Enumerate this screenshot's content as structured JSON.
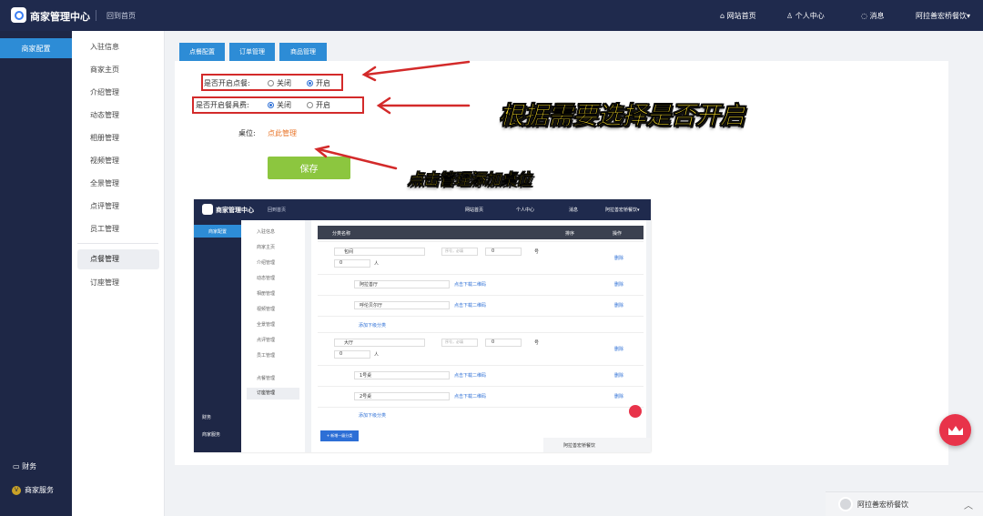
{
  "app": {
    "title": "商家管理中心",
    "home_link": "回到首页"
  },
  "header": {
    "links": [
      "网站首页",
      "个人中心",
      "消息"
    ],
    "account": "阿拉善宏桥餐饮"
  },
  "sidenav": {
    "active": "商家配置",
    "bottom": [
      "财务",
      "商家服务"
    ]
  },
  "subnav": {
    "items": [
      "入驻信息",
      "商家主页",
      "介绍管理",
      "动态管理",
      "相册管理",
      "视频管理",
      "全景管理",
      "点评管理",
      "员工管理"
    ],
    "active": "点餐管理",
    "after": "订座管理"
  },
  "tabs": [
    "点餐配置",
    "订单管理",
    "商品管理"
  ],
  "form": {
    "q1": "是否开启点餐:",
    "q2": "是否开启餐具费:",
    "off": "关闭",
    "on": "开启",
    "table_label": "桌位:",
    "table_link": "点此管理",
    "save": "保存"
  },
  "callouts": {
    "c1": "根据需要选择是否开启",
    "c2": "点击管理添加桌位"
  },
  "preview": {
    "title": "商家管理中心",
    "home": "回到首页",
    "links": [
      "网站首页",
      "个人中心",
      "消息",
      "阿拉善宏桥餐饮▾"
    ],
    "side_active": "商家配置",
    "side_bottom": [
      "财务",
      "商家服务"
    ],
    "sub_items": [
      "入驻信息",
      "商家主页",
      "介绍管理",
      "动态管理",
      "相册管理",
      "视频管理",
      "全景管理",
      "点评管理",
      "员工管理",
      "点餐管理"
    ],
    "sub_active": "订座管理",
    "columns": [
      "分类名称",
      "排序",
      "操作"
    ],
    "cat1": "包间",
    "cat2": "大厅",
    "hint": "序号，必填",
    "zero": "0",
    "num_suffix": "号",
    "person": "人",
    "rows1": [
      "阿拉善厅",
      "呼伦贝尔厅"
    ],
    "rows2": [
      "1号桌",
      "2号桌"
    ],
    "qrcode": "点击下载二维码",
    "add_child": "添加下级分类",
    "delete": "删除",
    "add_cat": "+ 新增一级分类",
    "chat": "阿拉善宏桥餐饮"
  },
  "chat": {
    "name": "阿拉善宏桥餐饮"
  },
  "colors": {
    "nav": "#1f2a4d",
    "tab": "#2d8cd6",
    "save": "#8cc63f",
    "link": "#e8752a",
    "annotation": "#d32a2a",
    "callout": "#f7dc2a"
  }
}
